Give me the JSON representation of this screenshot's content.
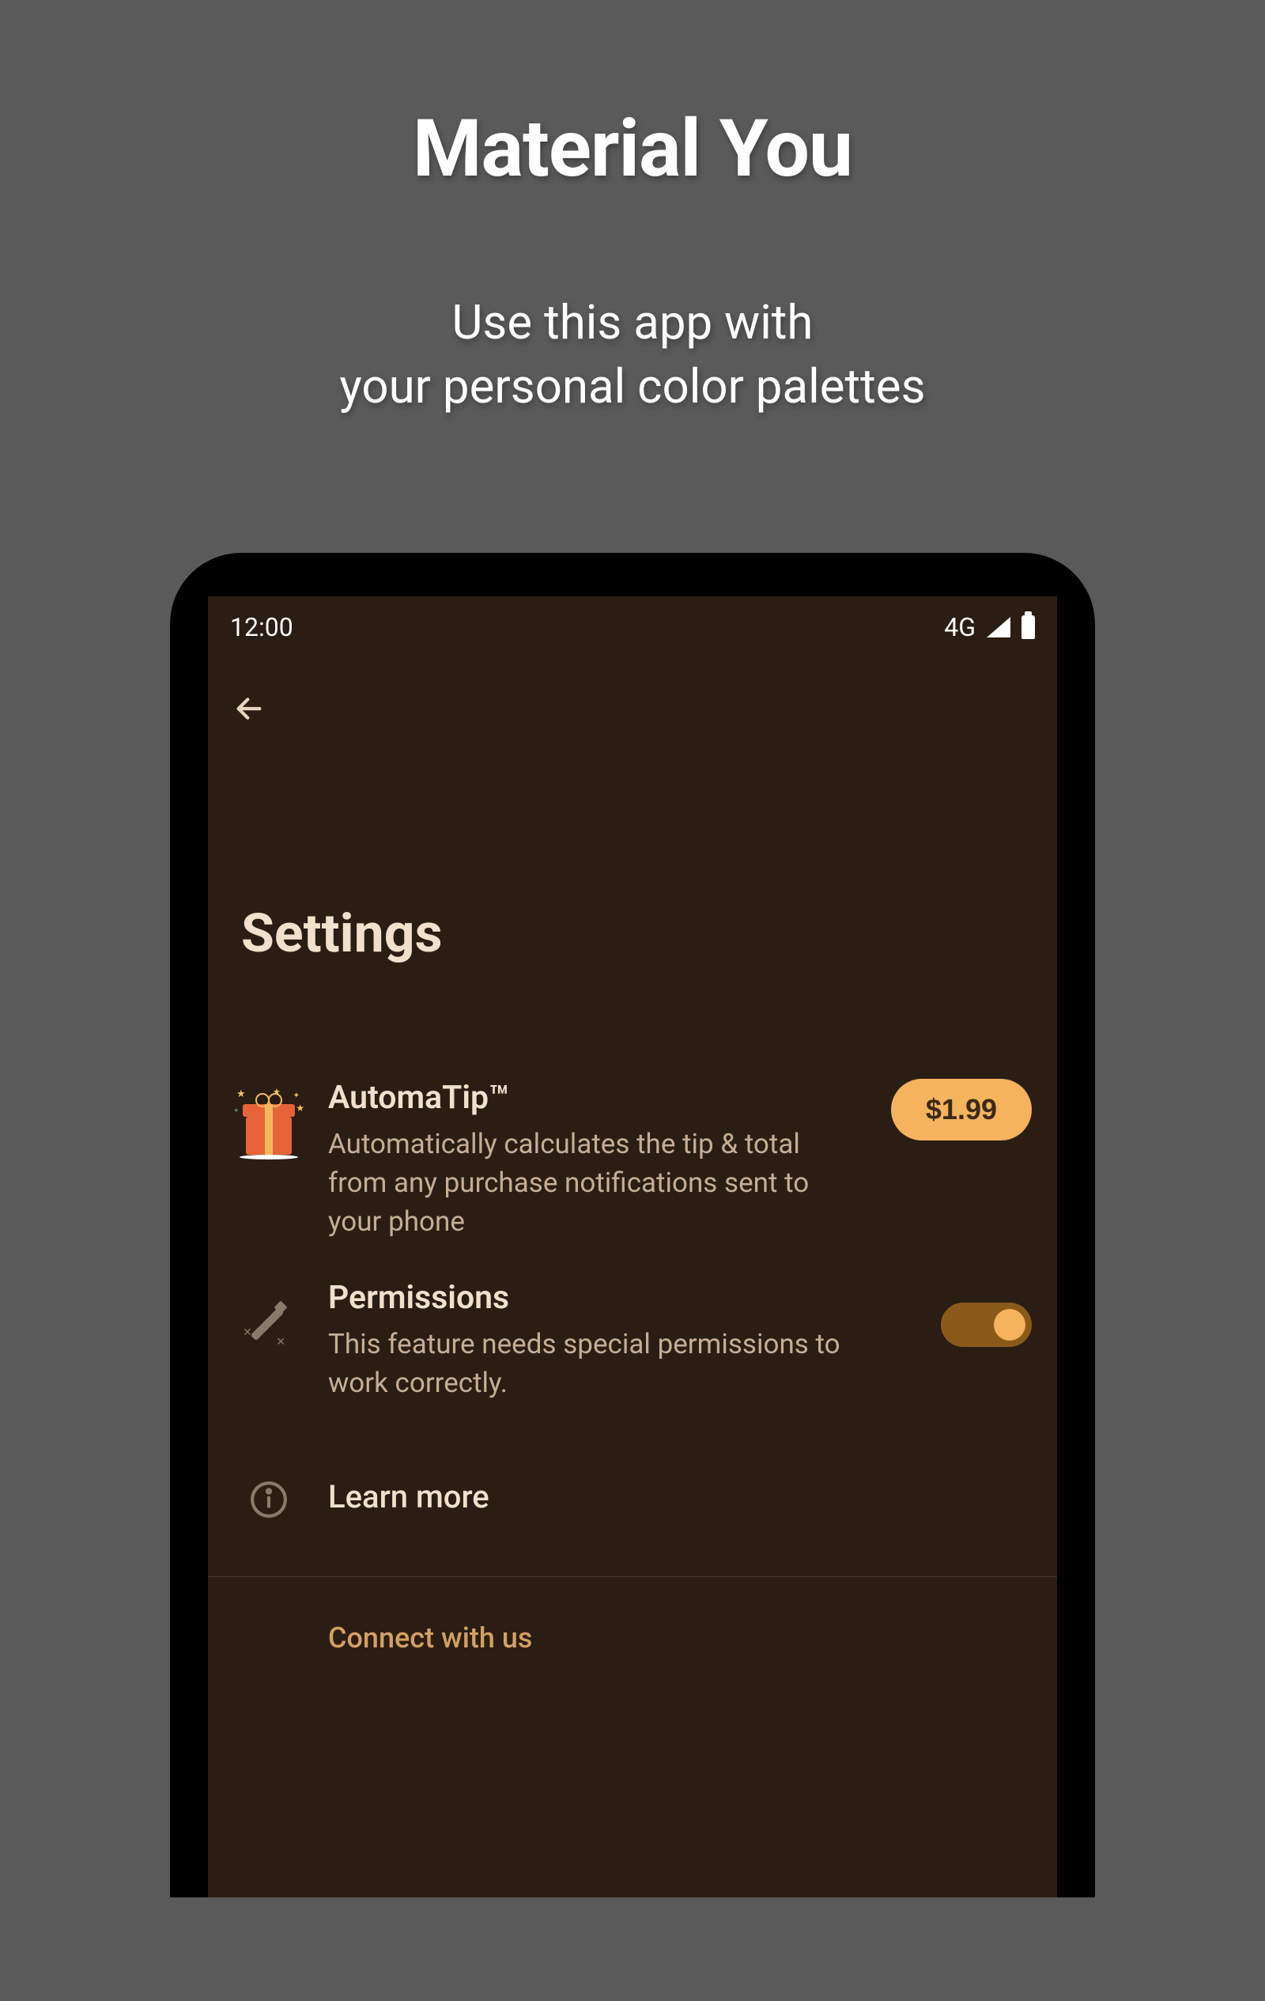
{
  "promo": {
    "title": "Material You",
    "subtitle_line1": "Use this app with",
    "subtitle_line2": "your personal color palettes"
  },
  "status_bar": {
    "time": "12:00",
    "network": "4G"
  },
  "page": {
    "title": "Settings"
  },
  "automatip": {
    "title": "AutomaTip™",
    "description": "Automatically calculates the tip & total from any purchase notifications sent to your phone",
    "price": "$1.99"
  },
  "permissions": {
    "title": "Permissions",
    "description": "This feature needs special permissions to work correctly.",
    "toggle_on": true
  },
  "learn_more": {
    "label": "Learn more"
  },
  "connect": {
    "title": "Connect with us"
  }
}
